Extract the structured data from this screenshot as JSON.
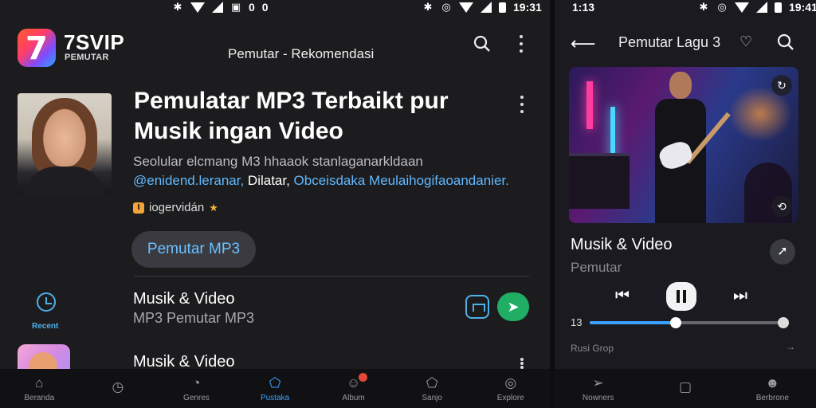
{
  "status_left": {
    "time": "",
    "mid_a": "0",
    "mid_b": "0"
  },
  "status_left_right": {
    "time": "19:31"
  },
  "status_right": {
    "time_left": "1:13",
    "time_right": "19:41"
  },
  "app": {
    "brand": "7SVIP",
    "brand_sub": "PEMUTAR",
    "header_title": "Pemutar - Rekomendasi"
  },
  "hero": {
    "title": "Pemulatar MP3 Terbaikt pur Musik ingan Video",
    "desc_line1": "Seolular elcmang M3 hhaaok stanlaganarkldaan",
    "desc_link1": "@enidend.leranar,",
    "desc_mid": " Dilatar, ",
    "desc_link2": "Obceisdaka Meulaihogifaoandanier.",
    "chip_label": "iogervidán",
    "chip_icon": "bookmark-icon",
    "pill_label": "Pemutar MP3"
  },
  "recent": {
    "label": "Recent"
  },
  "list": [
    {
      "title": "Musik & Video",
      "subtitle": "MP3 Pemutar MP3"
    },
    {
      "title": "Musik & Video",
      "subtitle": ""
    }
  ],
  "nav_left": [
    {
      "label": "Beranda",
      "icon": "home-icon"
    },
    {
      "label": "",
      "icon": "clock-icon"
    },
    {
      "label": "Genres",
      "icon": "genres-icon"
    },
    {
      "label": "Pustaka",
      "icon": "library-icon"
    },
    {
      "label": "Album",
      "icon": "album-icon"
    },
    {
      "label": "Sanjo",
      "icon": "playlist-icon"
    },
    {
      "label": "Explore",
      "icon": "explore-icon"
    }
  ],
  "player": {
    "title": "Pemutar Lagu 3",
    "song": "Musik & Video",
    "artist": "Pemutar",
    "time_current": "13",
    "progress_fraction": 0.45,
    "up_next": "Rusi Grop"
  },
  "nav_right": [
    {
      "label": "Nowners",
      "icon": "send-icon"
    },
    {
      "label": "",
      "icon": "square-icon"
    },
    {
      "label": "Berbrone",
      "icon": "profile-icon"
    }
  ],
  "colors": {
    "accent": "#3aa3ff",
    "play_green": "#1fae63",
    "badge_red": "#e5483a"
  }
}
